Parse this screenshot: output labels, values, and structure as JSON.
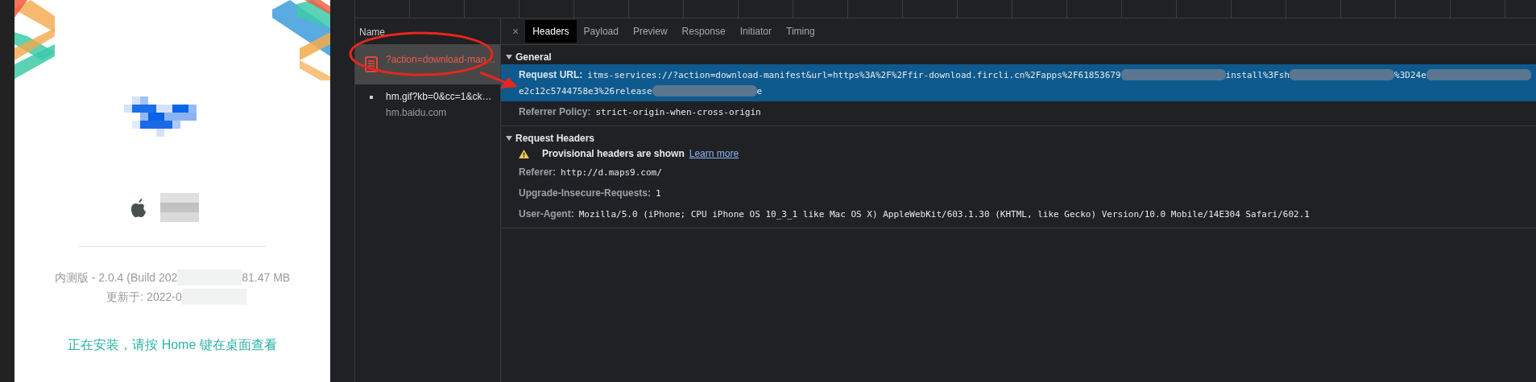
{
  "app_page": {
    "version_line": [
      "内测版 - 2.0.4 (Build 202",
      "81.47 MB"
    ],
    "updated_line": "更新于: 2022-0",
    "install_hint": "正在安装，请按 Home 键在桌面查看"
  },
  "network": {
    "name_header": "Name",
    "requests": [
      {
        "name": "?action=download-man…",
        "failed": true,
        "selected": true,
        "kind": "document"
      },
      {
        "name": "hm.gif?kb=0&cc=1&ck…",
        "domain": "hm.baidu.com",
        "failed": false,
        "selected": false,
        "kind": "image"
      }
    ]
  },
  "details": {
    "close": "×",
    "tabs": [
      {
        "label": "Headers",
        "selected": true
      },
      {
        "label": "Payload",
        "selected": false
      },
      {
        "label": "Preview",
        "selected": false
      },
      {
        "label": "Response",
        "selected": false
      },
      {
        "label": "Initiator",
        "selected": false
      },
      {
        "label": "Timing",
        "selected": false
      }
    ],
    "sections": [
      {
        "title": "General",
        "expanded": true,
        "rows": [
          {
            "label": "Request URL:",
            "highlighted": true,
            "lines": [
              [
                {
                  "kind": "text",
                  "text": "itms-services://?action=download-manifest&url=https%3A%2F%2Ffir-download.fircli.cn%2Fapps%2F61853679"
                },
                {
                  "kind": "blur"
                },
                {
                  "kind": "text",
                  "text": "install%3Fsh"
                },
                {
                  "kind": "blur"
                },
                {
                  "kind": "text",
                  "text": "%3D24e"
                },
                {
                  "kind": "blur"
                }
              ],
              [
                {
                  "kind": "text",
                  "text": "e2c12c5744758e3%26release"
                },
                {
                  "kind": "blur"
                },
                {
                  "kind": "text",
                  "text": "e"
                }
              ]
            ]
          },
          {
            "label": "Referrer Policy:",
            "highlighted": false,
            "lines": [
              [
                {
                  "kind": "text",
                  "text": "strict-origin-when-cross-origin"
                }
              ]
            ]
          }
        ]
      },
      {
        "title": "Request Headers",
        "expanded": true,
        "warning": {
          "text": "Provisional headers are shown",
          "link": "Learn more"
        },
        "rows": [
          {
            "label": "Referer:",
            "highlighted": false,
            "lines": [
              [
                {
                  "kind": "text",
                  "text": "http://d.maps9.com/"
                }
              ]
            ]
          },
          {
            "label": "Upgrade-Insecure-Requests:",
            "highlighted": false,
            "lines": [
              [
                {
                  "kind": "text",
                  "text": "1"
                }
              ]
            ]
          },
          {
            "label": "User-Agent:",
            "highlighted": false,
            "lines": [
              [
                {
                  "kind": "text",
                  "text": "Mozilla/5.0 (iPhone; CPU iPhone OS 10_3_1 like Mac OS X) AppleWebKit/603.1.30 (KHTML, like Gecko) Version/10.0 Mobile/14E304 Safari/602.1"
                }
              ]
            ]
          }
        ]
      }
    ]
  }
}
